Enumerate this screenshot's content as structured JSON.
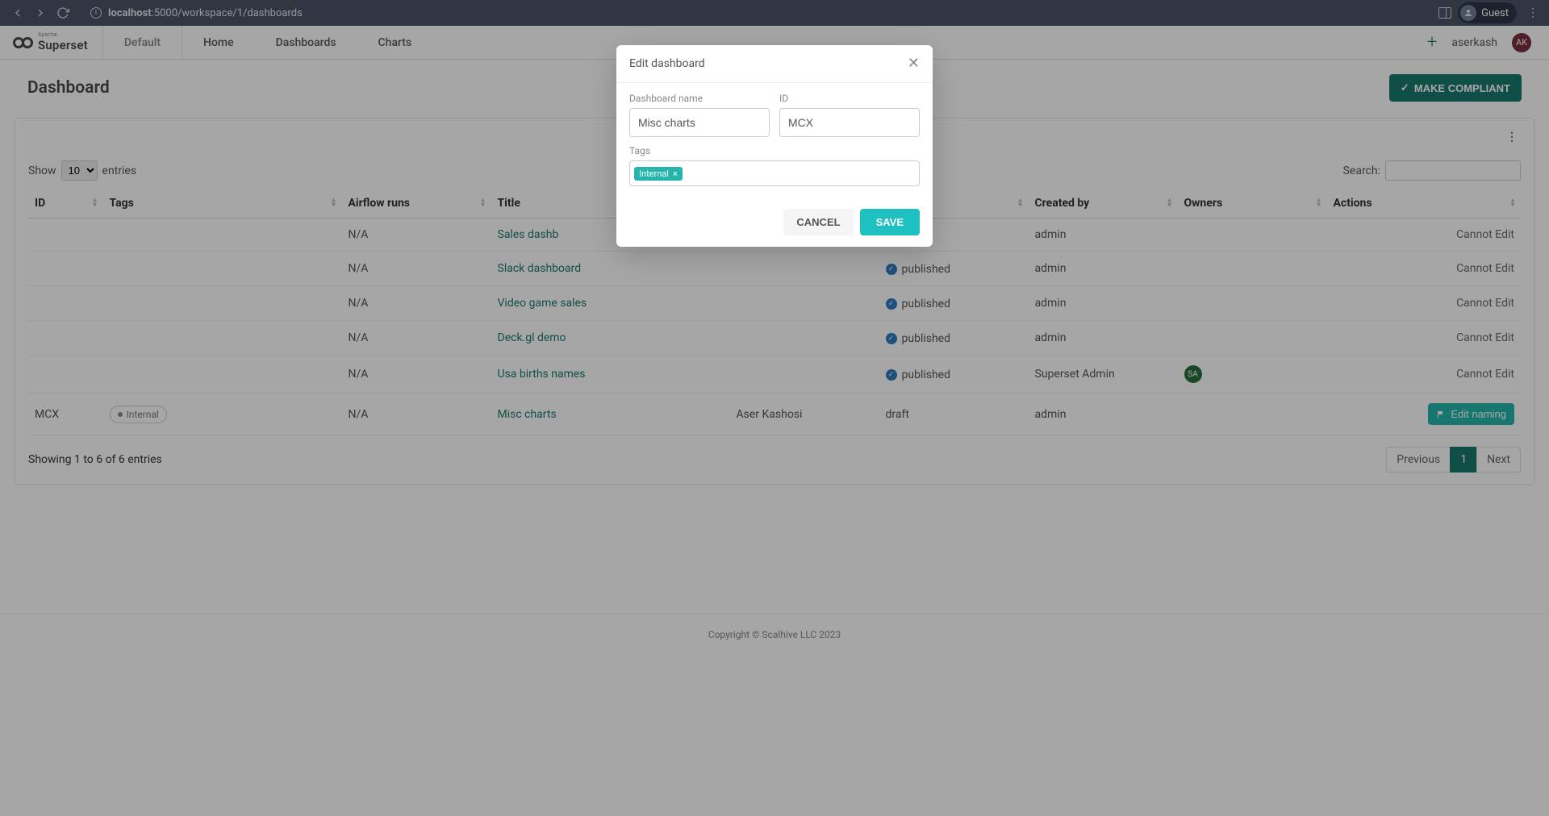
{
  "browser": {
    "url_prefix": "localhost",
    "url_rest": ":5000/workspace/1/dashboards",
    "guest_label": "Guest"
  },
  "header": {
    "logo_text": "Superset",
    "logo_sub": "Apache",
    "default_label": "Default",
    "nav": {
      "home": "Home",
      "dashboards": "Dashboards",
      "charts": "Charts"
    },
    "username": "aserkash",
    "user_initials": "AK"
  },
  "page": {
    "title": "Dashboard",
    "compliant_btn": "MAKE COMPLIANT"
  },
  "table": {
    "show_label": "Show",
    "entries_label": "entries",
    "show_value": "10",
    "search_label": "Search:",
    "columns": {
      "id": "ID",
      "tags": "Tags",
      "airflow": "Airflow runs",
      "title": "Title",
      "changedby": "",
      "published": "",
      "createdby": "Created by",
      "owners": "Owners",
      "actions": "Actions"
    },
    "info_text": "Showing 1 to 6 of 6 entries",
    "prev": "Previous",
    "page1": "1",
    "next": "Next",
    "published_label": "published",
    "draft_label": "draft",
    "cannot_edit": "Cannot Edit",
    "edit_naming": "Edit naming",
    "rows": [
      {
        "id": "",
        "tag": "",
        "airflow": "N/A",
        "title": "Sales dashb",
        "changedby": "",
        "pub": "",
        "createdby": "admin",
        "owners": "",
        "action": "cannot"
      },
      {
        "id": "",
        "tag": "",
        "airflow": "N/A",
        "title": "Slack dashboard",
        "changedby": "",
        "pub": "published",
        "createdby": "admin",
        "owners": "",
        "action": "cannot"
      },
      {
        "id": "",
        "tag": "",
        "airflow": "N/A",
        "title": "Video game sales",
        "changedby": "",
        "pub": "published",
        "createdby": "admin",
        "owners": "",
        "action": "cannot"
      },
      {
        "id": "",
        "tag": "",
        "airflow": "N/A",
        "title": "Deck.gl demo",
        "changedby": "",
        "pub": "published",
        "createdby": "admin",
        "owners": "",
        "action": "cannot"
      },
      {
        "id": "",
        "tag": "",
        "airflow": "N/A",
        "title": "Usa births names",
        "changedby": "",
        "pub": "published",
        "createdby": "Superset Admin",
        "owners": "SA",
        "action": "cannot"
      },
      {
        "id": "MCX",
        "tag": "Internal",
        "airflow": "N/A",
        "title": "Misc charts",
        "changedby": "Aser Kashosi",
        "pub": "draft",
        "createdby": "admin",
        "owners": "",
        "action": "edit"
      }
    ]
  },
  "footer": {
    "copyright": "Copyright © Scalhive LLC 2023"
  },
  "modal": {
    "title": "Edit dashboard",
    "name_label": "Dashboard name",
    "name_value": "Misc charts",
    "id_label": "ID",
    "id_value": "MCX",
    "tags_label": "Tags",
    "tag_token": "Internal",
    "cancel": "CANCEL",
    "save": "SAVE"
  }
}
